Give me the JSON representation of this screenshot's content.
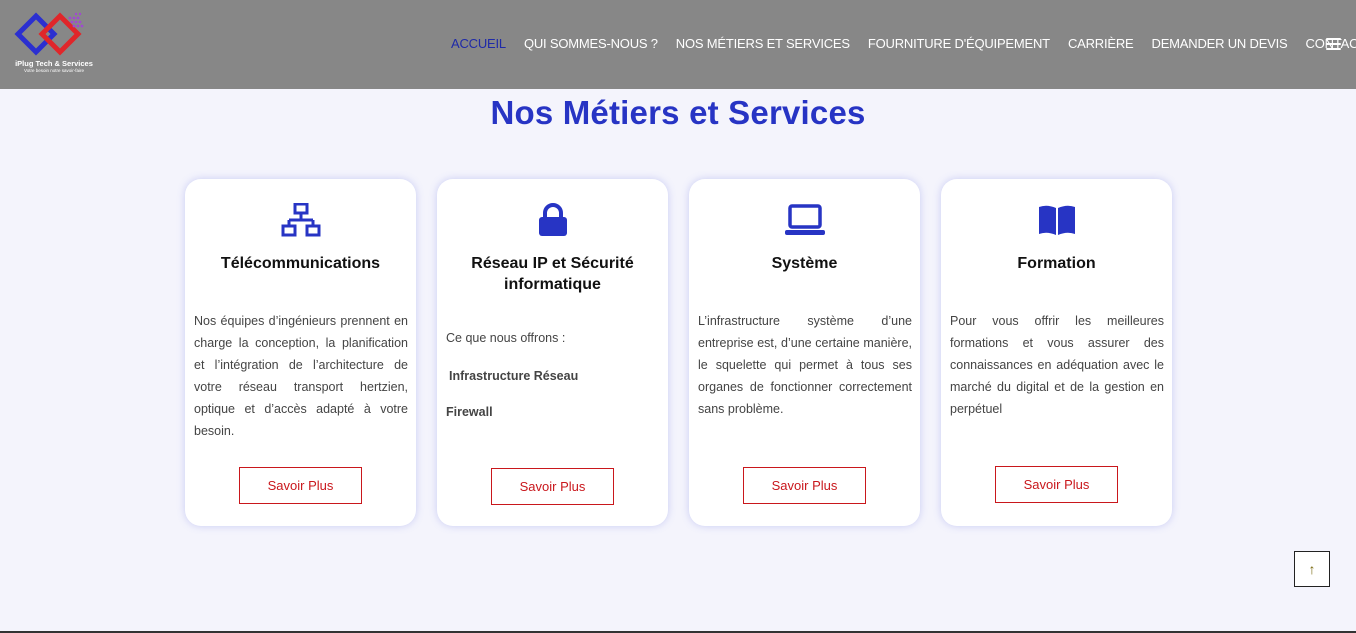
{
  "brand": {
    "name": "iPlug Tech & Services",
    "tagline": "Votre besoin notre savoir-faire"
  },
  "nav": {
    "items": [
      "ACCUEIL",
      "QUI SOMMES-NOUS ?",
      "NOS MÉTIERS ET SERVICES",
      "FOURNITURE D'ÉQUIPEMENT",
      "CARRIÈRE",
      "DEMANDER UN DEVIS",
      "CONTACT"
    ],
    "active_index": 0
  },
  "section": {
    "title": "Nos Métiers et Services"
  },
  "cards": [
    {
      "icon": "network-icon",
      "title": "Télécommunications",
      "text": "Nos équipes d’ingénieurs prennent en charge la conception, la planification et l’intégration de l’architecture de votre réseau transport hertzien, optique et d’accès adapté à votre besoin.",
      "button": "Savoir Plus"
    },
    {
      "icon": "lock-icon",
      "title": "Réseau IP et Sécurité informatique",
      "list_intro": "Ce que nous offrons :",
      "list": [
        "Infrastructure Réseau",
        "Firewall"
      ],
      "button": "Savoir Plus"
    },
    {
      "icon": "laptop-icon",
      "title": "Système",
      "text": "L’infrastructure système d’une entreprise est, d’une certaine manière, le squelette qui permet à tous ses organes de fonctionner correctement sans problème.",
      "button": "Savoir Plus"
    },
    {
      "icon": "book-icon",
      "title": "Formation",
      "text": "Pour vous offrir les meilleures formations et vous assurer des connaissances en adéquation avec le marché du digital et de la gestion en perpétuel",
      "button": "Savoir Plus"
    }
  ],
  "scroll_top": {
    "icon": "arrow-up-icon",
    "label": "↑"
  },
  "colors": {
    "header_bg": "#878787",
    "accent_blue": "#2734c4",
    "button_red": "#c9171c",
    "page_bg": "#f4f4fc"
  }
}
